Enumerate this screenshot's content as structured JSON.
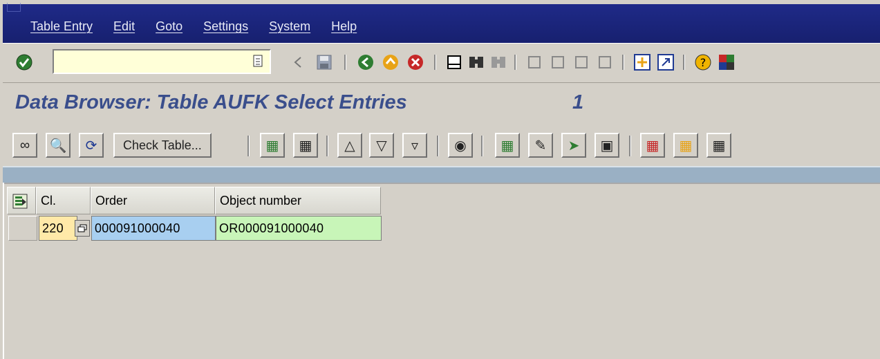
{
  "menubar": {
    "items": [
      {
        "label": "Table Entry"
      },
      {
        "label": "Edit"
      },
      {
        "label": "Goto"
      },
      {
        "label": "Settings"
      },
      {
        "label": "System"
      },
      {
        "label": "Help"
      }
    ]
  },
  "std_toolbar": {
    "command_value": "",
    "icons": [
      "enter-icon",
      "dropdown-icon",
      "back-arrow-icon",
      "save-icon",
      "back-icon",
      "exit-icon",
      "cancel-icon",
      "print-icon",
      "find-icon",
      "find-next-icon",
      "first-page-icon",
      "previous-page-icon",
      "next-page-icon",
      "last-page-icon",
      "create-session-icon",
      "shortcut-icon",
      "help-icon",
      "layout-menu-icon"
    ]
  },
  "title": {
    "text": "Data Browser: Table AUFK Select Entries",
    "count": "1"
  },
  "app_toolbar": {
    "check_table_label": "Check Table..."
  },
  "table": {
    "columns": [
      "Cl.",
      "Order",
      "Object number"
    ],
    "rows": [
      {
        "client": "220",
        "order": "000091000040",
        "object_number": "OR000091000040"
      }
    ]
  },
  "colors": {
    "menubar_bg": "#1a237e",
    "title": "#3a4e8c",
    "client_cell": "#ffe9a8",
    "order_cell": "#a8cff0",
    "object_cell": "#c8f5b8"
  }
}
